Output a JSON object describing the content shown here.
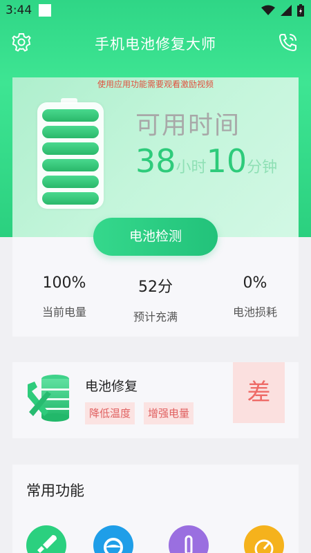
{
  "status": {
    "time": "3:44"
  },
  "app": {
    "title": "手机电池修复大师"
  },
  "notice": "使用应用功能需要观看激励视频",
  "battery": {
    "available_label": "可用时间",
    "hours": "38",
    "hours_unit": "小时",
    "minutes": "10",
    "minutes_unit": "分钟",
    "detect_button": "电池检测"
  },
  "stats": [
    {
      "value": "100%",
      "label": "当前电量"
    },
    {
      "value": "52分",
      "label": "预计充满"
    },
    {
      "value": "0%",
      "label": "电池损耗"
    }
  ],
  "repair": {
    "title": "电池修复",
    "tags": [
      "降低温度",
      "增强电量"
    ],
    "grade": "差"
  },
  "functions": {
    "title": "常用功能"
  },
  "colors": {
    "primary_green": "#2ecb7b",
    "grade_red": "#ee6a66",
    "notice_red": "#e0503d"
  }
}
